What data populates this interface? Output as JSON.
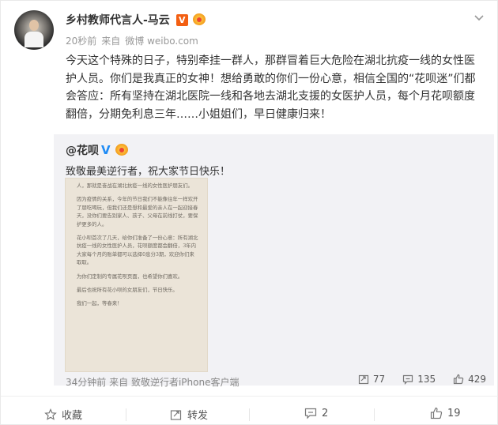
{
  "post": {
    "author": "乡村教师代言人-马云",
    "verified_badge": "V",
    "time": "20秒前",
    "source_prefix": "来自",
    "source": "微博 weibo.com",
    "paragraph": "今天这个特殊的日子，特别牵挂一群人，那群冒着巨大危险在湖北抗疫一线的女性医护人员。你们是我真正的女神！想给勇敢的你们一份心意，相信全国的“花呗迷”们都会答应：所有坚持在湖北医院一线和各地去湖北支援的女医护人员，每个月花呗额度翻倍，分期免利息三年……小姐姐们，早日健康归来！"
  },
  "repost": {
    "author": "@花呗",
    "verified_badge": "V",
    "text": "致敬最美逆行者，祝大家节日快乐！",
    "time": "34分钟前",
    "source_prefix": "来自",
    "source": "致敬逆行者iPhone客户端",
    "stats": {
      "reposts": "77",
      "comments": "135",
      "likes": "429"
    },
    "letter_paragraphs": [
      "人，那就是奋战在湖北抗疫一线的女性医护朋友们。",
      "因为疫情的关系，今年的节日我们不能像往年一样欢开了朋吃喝玩，但我们还是想和最爱的亲人在一起迎接春天，没你们要告别家人、孩子、父母在前线打仗，要保护更多的人。",
      "花小呗首次了几天，给你们准备了一份心意：所有湖北抗疫一线的女性医护人员，花呗额度都会翻倍，3年内大家每个月的账单都可以选择0息分3期，欢迎你们来取取。",
      "为你们定制的专属花呗页面，也希望你们喜欢。",
      "最后也祝所有花小呗的女朋友们，节日快乐。",
      "我们一起，等春来！"
    ]
  },
  "actions": {
    "favorite": "收藏",
    "repost": "转发",
    "comment": "2",
    "like": "19"
  },
  "colors": {
    "v_badge": "#f35f12",
    "repost_v": "#1f8bf5",
    "repost_bg": "#f2f2f5",
    "letter_bg": "#ebe4d8"
  }
}
